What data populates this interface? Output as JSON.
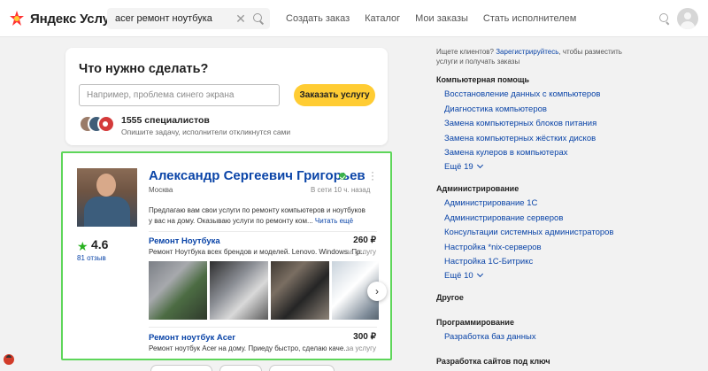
{
  "header": {
    "logo_text": "Яндекс Услуги",
    "search_value": "acer ремонт ноутбука",
    "nav": [
      "Создать заказ",
      "Каталог",
      "Мои заказы",
      "Стать исполнителем"
    ]
  },
  "order": {
    "title": "Что нужно сделать?",
    "input_placeholder": "Например, проблема синего экрана",
    "button_label": "Заказать услугу",
    "specialists_count": "1555 специалистов",
    "specialists_sub": "Опишите задачу, исполнители откликнутся сами"
  },
  "profile": {
    "name": "Александр Сергеевич Григорьев",
    "city": "Москва",
    "online": "В сети 10 ч. назад",
    "description": "Предлагаю вам свои услуги по ремонту компьютеров и ноутбуков у вас на дому. Оказываю услуги по ремонту ком...",
    "read_more": "Читать ещё",
    "rating": "4.6",
    "rating_star": "★",
    "reviews": "81 отзыв",
    "services": [
      {
        "title": "Ремонт Ноутбука",
        "desc": "Ремонт Ноутбука всех брендов и моделей. Lenovo. Windows. Пр...",
        "price": "260 ₽",
        "unit": "за услугу"
      },
      {
        "title": "Ремонт ноутбук Acer",
        "desc": "Ремонт ноутбук Acer на дому. Приеду быстро, сделаю каче...",
        "price": "300 ₽",
        "unit": "за услугу"
      }
    ]
  },
  "sidebar": {
    "promo_prefix": "Ищете клиентов? ",
    "promo_link": "Зарегистрируйтесь",
    "promo_suffix": ", чтобы разместить услуги и получать заказы",
    "categories": [
      {
        "title": "Компьютерная помощь",
        "links": [
          "Восстановление данных с компьютеров",
          "Диагностика компьютеров",
          "Замена компьютерных блоков питания",
          "Замена компьютерных жёстких дисков",
          "Замена кулеров в компьютерах"
        ],
        "more": "Ещё 19"
      },
      {
        "title": "Администрирование",
        "links": [
          "Администрирование 1С",
          "Администрирование серверов",
          "Консультации системных администраторов",
          "Настройка *nix-серверов",
          "Настройка 1С-Битрикс"
        ],
        "more": "Ещё 10"
      },
      {
        "title": "Другое",
        "links": []
      },
      {
        "title": "Программирование",
        "links": [
          "Разработка баз данных"
        ]
      },
      {
        "title": "Разработка сайтов под ключ",
        "links": []
      }
    ]
  },
  "colors": {
    "accent_yellow": "#ffcc33",
    "link_blue": "#0b45a8",
    "highlight_green": "#5ed65a",
    "rating_green": "#28b11f"
  }
}
